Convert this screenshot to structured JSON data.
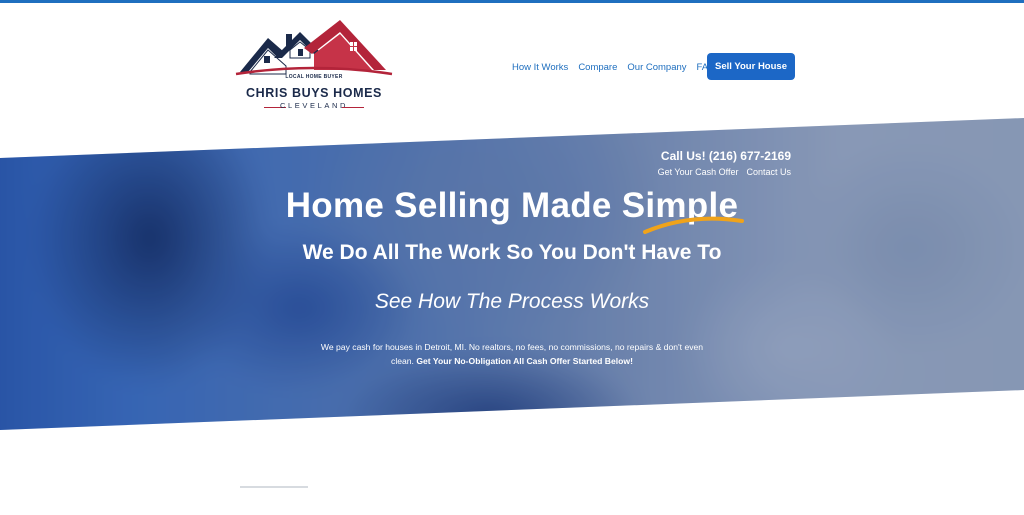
{
  "logo": {
    "tagline": "LOCAL HOME BUYER",
    "name": "CHRIS BUYS HOMES",
    "city": "CLEVELAND"
  },
  "nav": {
    "items": [
      {
        "label": "How It Works"
      },
      {
        "label": "Compare"
      },
      {
        "label": "Our Company"
      },
      {
        "label": "FAQ"
      }
    ],
    "cta_label": "Sell Your House"
  },
  "hero": {
    "call": "Call Us! (216) 677-2169",
    "links": [
      {
        "label": "Get Your Cash Offer"
      },
      {
        "label": "Contact Us"
      }
    ],
    "title": "Home Selling Made Simple",
    "subtitle": "We Do All The Work So You Don't Have To",
    "process_link": "See How The Process Works",
    "body_text": "We pay cash for houses in Detroit, MI. No realtors, no fees, no commissions, no repairs & don't even clean.",
    "body_bold": "Get Your No-Obligation All Cash Offer Started Below!"
  },
  "colors": {
    "accent": "#1c67c6",
    "brand_navy": "#1b2a4a",
    "brand_red": "#b3243a",
    "swoosh": "#f0a31a"
  },
  "icons": [
    "house-roof-logo-icon",
    "underline-swoosh-icon"
  ]
}
